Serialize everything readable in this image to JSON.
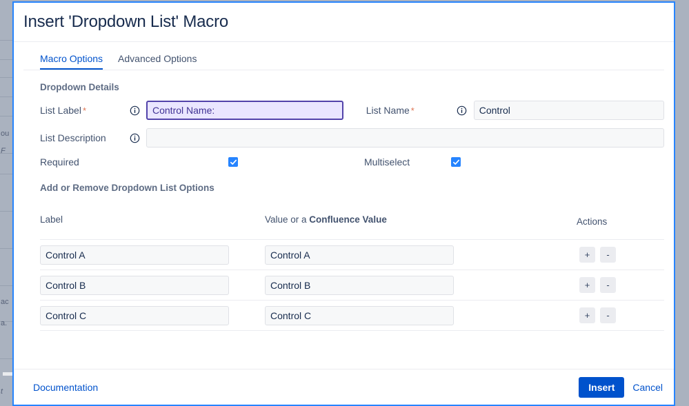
{
  "dialog": {
    "title": "Insert 'Dropdown List' Macro",
    "border_color": "#2684FF"
  },
  "tabs": [
    {
      "label": "Macro Options",
      "active": true
    },
    {
      "label": "Advanced Options",
      "active": false
    }
  ],
  "details": {
    "section_title": "Dropdown Details",
    "fields": {
      "list_label": {
        "label": "List Label",
        "required_marker": "*",
        "value": "Control Name:",
        "info_icon": "info-circle-icon",
        "focused": true,
        "highlight_bg": "#EAE6FF",
        "highlight_border": "#5243AA"
      },
      "list_name": {
        "label": "List Name",
        "required_marker": "*",
        "value": "Control",
        "info_icon": "info-circle-icon"
      },
      "list_description": {
        "label": "List Description",
        "value": "",
        "placeholder": "",
        "info_icon": "info-circle-icon"
      },
      "required": {
        "label": "Required",
        "checked": true
      },
      "multiselect": {
        "label": "Multiselect",
        "checked": true
      }
    }
  },
  "options": {
    "section_title": "Add or Remove Dropdown List Options",
    "headers": {
      "label": "Label",
      "value_prefix": "Value or a ",
      "value_link": "Confluence Value",
      "actions": "Actions"
    },
    "add_button": "+",
    "remove_button": "-",
    "rows": [
      {
        "label": "Control A",
        "value": "Control A"
      },
      {
        "label": "Control B",
        "value": "Control B"
      },
      {
        "label": "Control C",
        "value": "Control C"
      }
    ]
  },
  "footer": {
    "documentation": "Documentation",
    "insert": "Insert",
    "cancel": "Cancel",
    "primary_color": "#0052CC"
  },
  "background": {
    "fragments": [
      "ou",
      "F",
      "ac",
      "a.",
      "t"
    ]
  }
}
